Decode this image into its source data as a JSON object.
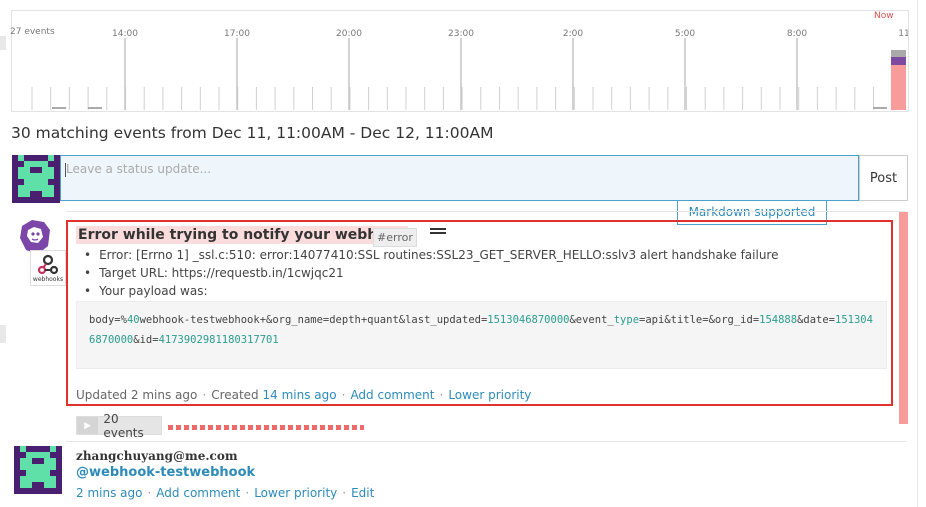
{
  "timeline": {
    "event_count_label": "27 events",
    "now_label": "Now",
    "time_labels": [
      "14:00",
      "17:00",
      "20:00",
      "23:00",
      "2:00",
      "5:00",
      "8:00",
      "11"
    ],
    "colors": {
      "error": "#f79b9b",
      "warning": "#7d4aa0",
      "info": "#aaaaaa"
    }
  },
  "heading": "30 matching events from Dec 11, 11:00AM - Dec 12, 11:00AM",
  "status": {
    "placeholder": "Leave a status update...",
    "post_label": "Post",
    "markdown_label": "Markdown supported"
  },
  "event": {
    "title": "Error while trying to notify your webhook",
    "tag": "#error",
    "source_label": "webhooks",
    "bullets": [
      "Error: [Errno 1] _ssl.c:510: error:14077410:SSL routines:SSL23_GET_SERVER_HELLO:sslv3 alert handshake failure",
      "Target URL: https://requestb.in/1cwjqc21",
      "Your payload was:"
    ],
    "payload_parts": [
      "body=%",
      "40",
      "webhook-testwebhook+&org_name=depth+quant&last_updated=",
      "1513046870000",
      "&event_",
      "type",
      "=api&title=&org_id=",
      "154888",
      "&date=",
      "1513046870000",
      "&id=",
      "4173902981180317701"
    ],
    "meta": {
      "updated": "Updated 2 mins ago",
      "created_prefix": "Created",
      "created_time": "14 mins ago",
      "add_comment": "Add comment",
      "lower_priority": "Lower priority"
    },
    "events_button": "20 events"
  },
  "comment": {
    "user": "zhangchuyang@me.com",
    "mention": "@webhook-testwebhook",
    "time": "2 mins ago",
    "add_comment": "Add comment",
    "lower_priority": "Lower priority",
    "edit": "Edit"
  }
}
